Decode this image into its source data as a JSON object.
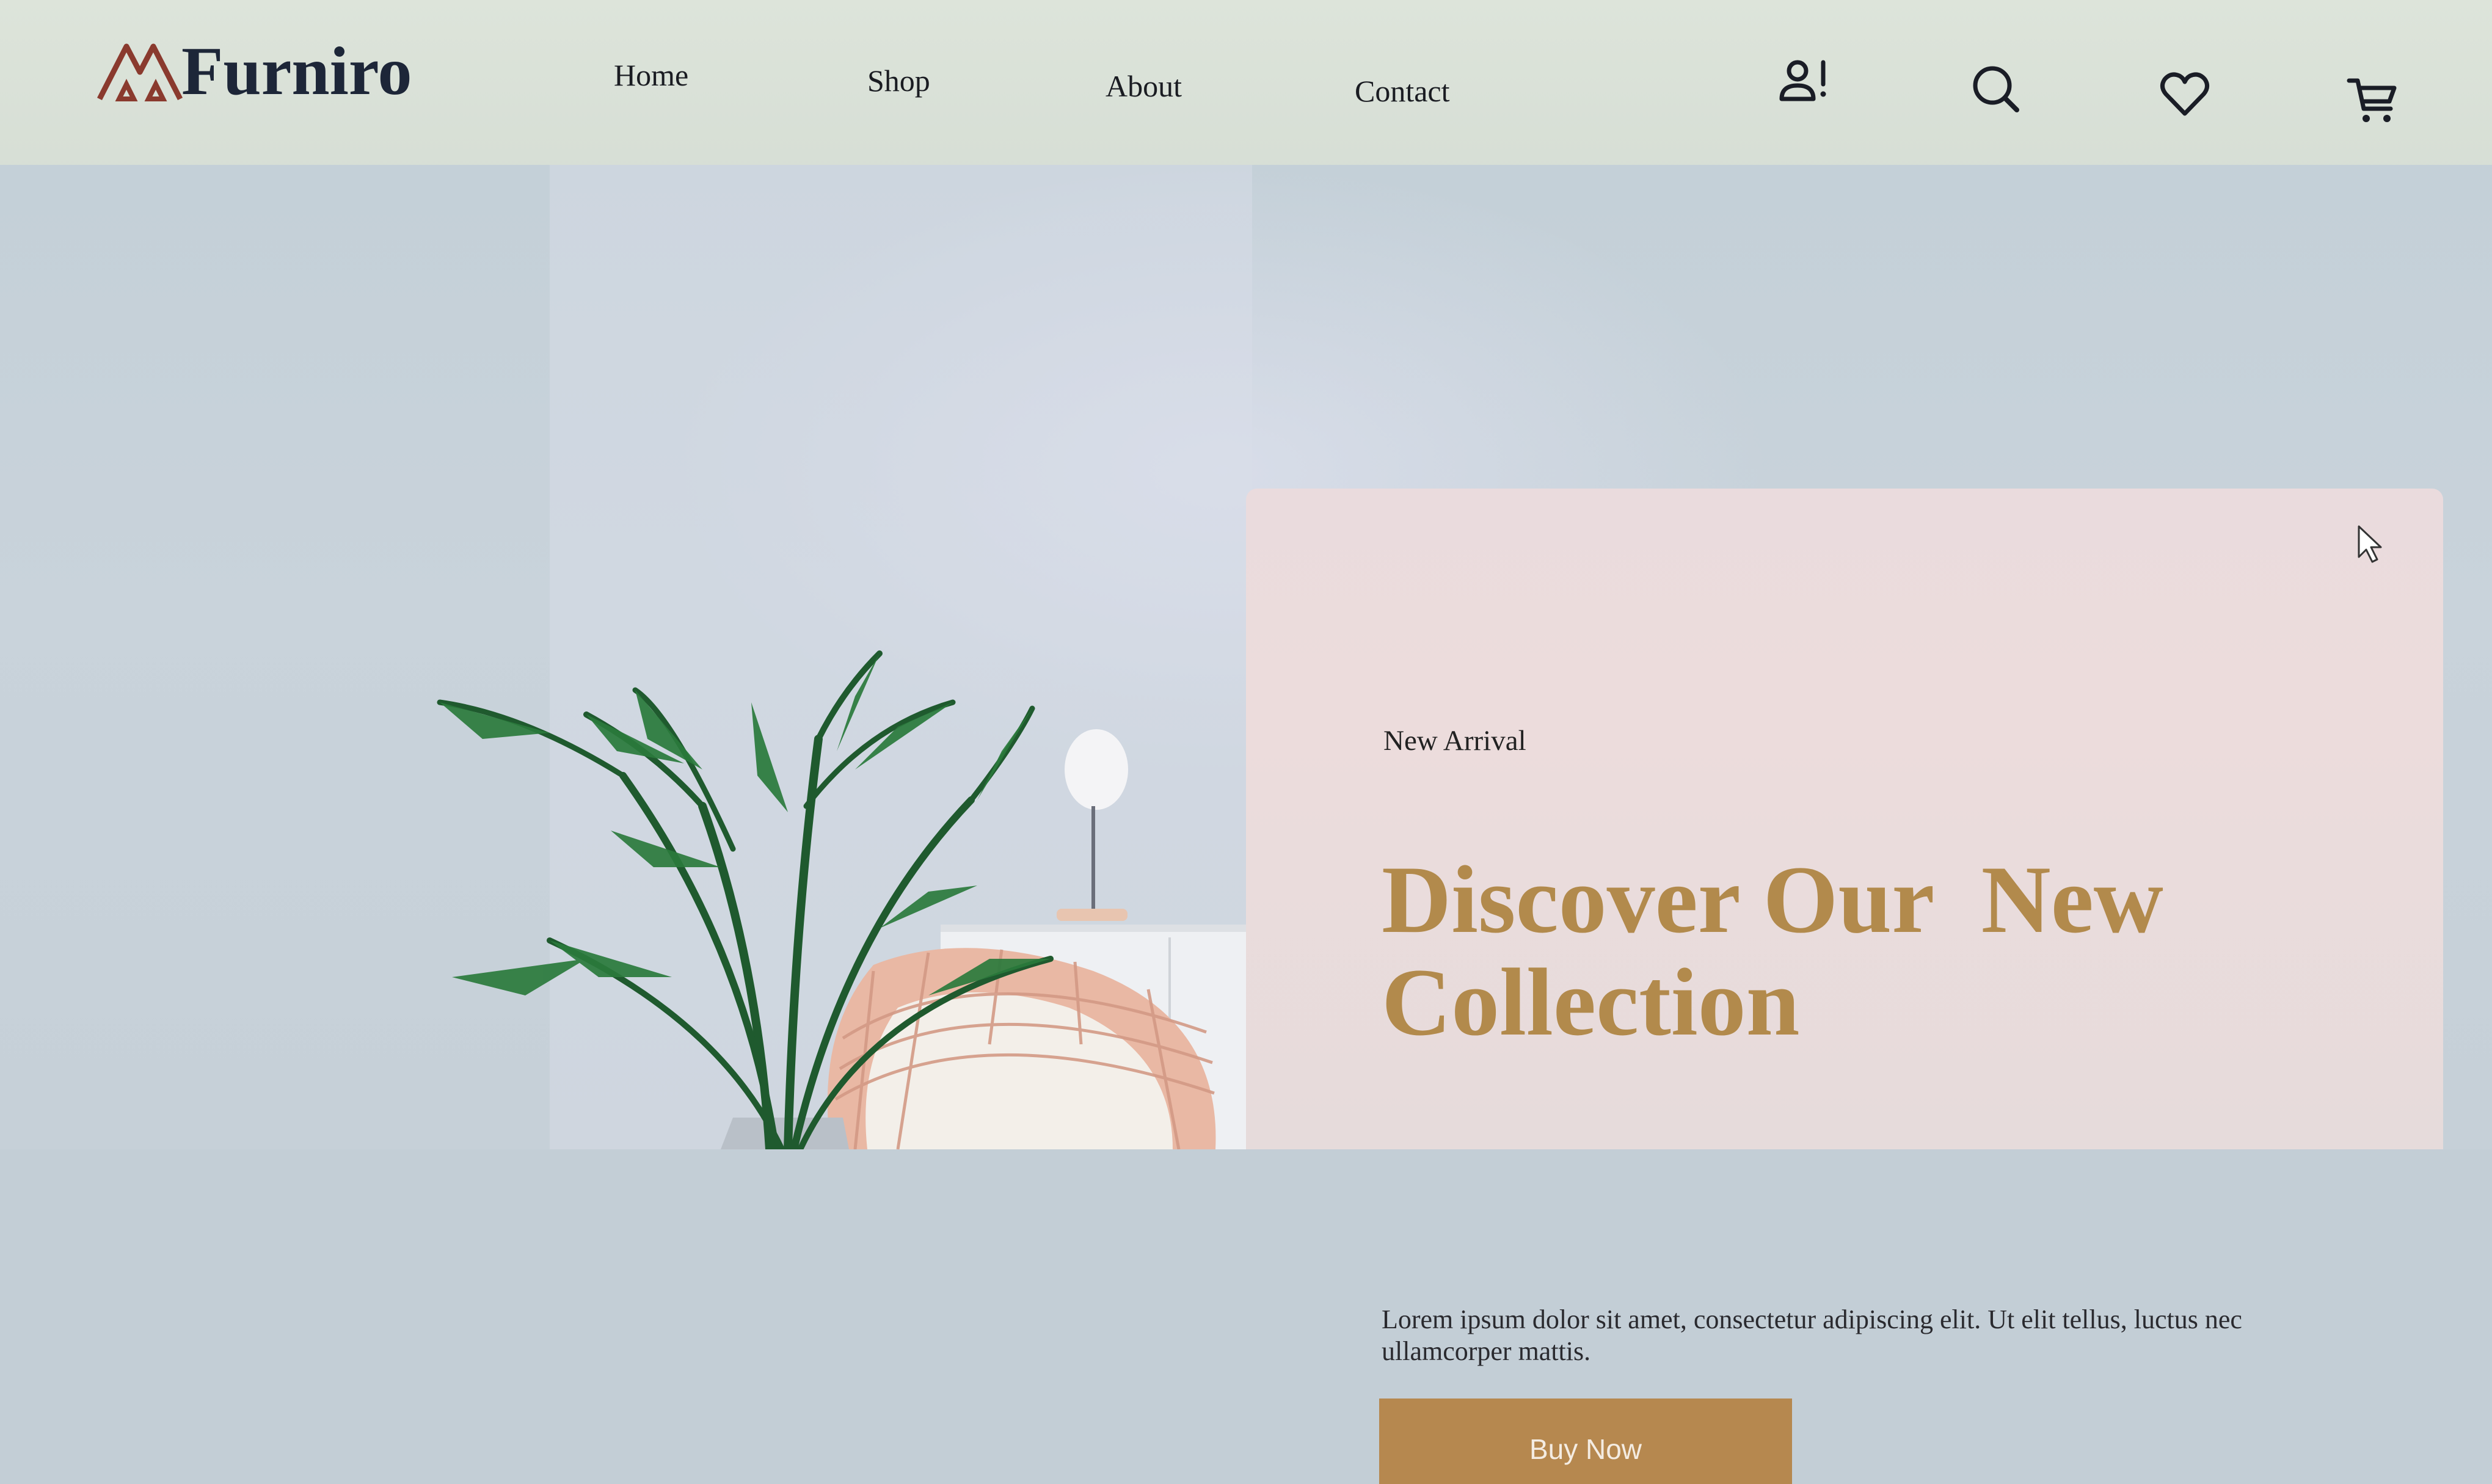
{
  "header": {
    "logo_text": "Furniro",
    "nav": {
      "home": "Home",
      "shop": "Shop",
      "about": "About",
      "contact": "Contact"
    },
    "icons": [
      "account-alert-icon",
      "search-icon",
      "heart-icon",
      "cart-icon"
    ]
  },
  "hero": {
    "eyebrow": "New Arrival",
    "headline": "Discover Our  New\nCollection",
    "description": "Lorem ipsum dolor sit amet, consectetur adipiscing elit. Ut elit tellus, luctus nec ullamcorper mattis.",
    "cta_label": "Buy Now"
  },
  "colors": {
    "brand_text": "#1d2638",
    "logo_accent": "#8a3a2e",
    "headline": "#b28a4c",
    "button": "#b6884f",
    "banner_bg": "#eadbdd"
  }
}
